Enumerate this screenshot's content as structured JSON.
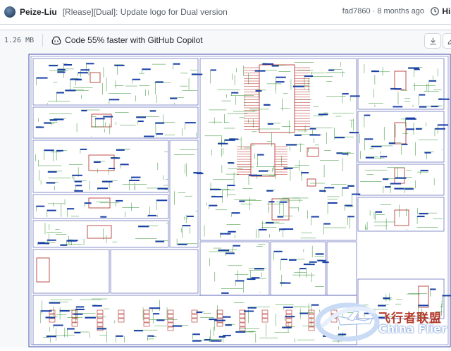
{
  "commit": {
    "author": "Peize-Liu",
    "message": "[Rlease][Dual]: Update logo for Dual version",
    "hash": "fad7860",
    "time": "8 months ago",
    "history_label": "His"
  },
  "toolbar": {
    "file_size": "1.26 MB",
    "copilot_text": "Code 55% faster with GitHub Copilot",
    "copilot_icon": "copilot-icon",
    "download_icon": "download-icon",
    "edit_icon": "pencil-icon"
  },
  "watermark": {
    "cn": "飞行者联盟",
    "en": "China Flier"
  },
  "colors": {
    "wire": "#2f8f2f",
    "part": "#b0261e",
    "frame": "#3b4aa8",
    "label": "#1a3fa8"
  }
}
